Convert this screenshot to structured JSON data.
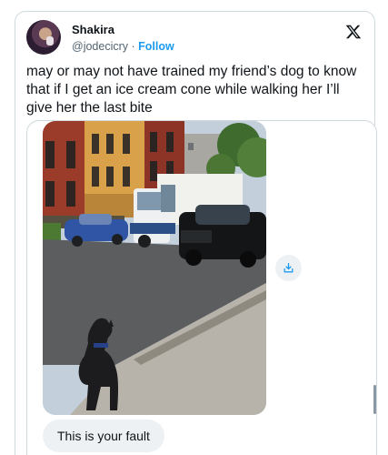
{
  "author": {
    "name": "Shakira",
    "handle": "@jodecicry",
    "separator": "·",
    "follow_label": "Follow"
  },
  "icons": {
    "brand": "x-logo-icon",
    "save": "save-download-icon"
  },
  "tweet": {
    "text": "may or may not have trained my friend’s dog to know that if I get an ice cream cone while walking her I’ll give her the last bite"
  },
  "media": {
    "caption": "This is your fault"
  },
  "colors": {
    "accent": "#1d9bf0",
    "text": "#0f1419",
    "secondary": "#536471",
    "border": "#cfd9de"
  }
}
